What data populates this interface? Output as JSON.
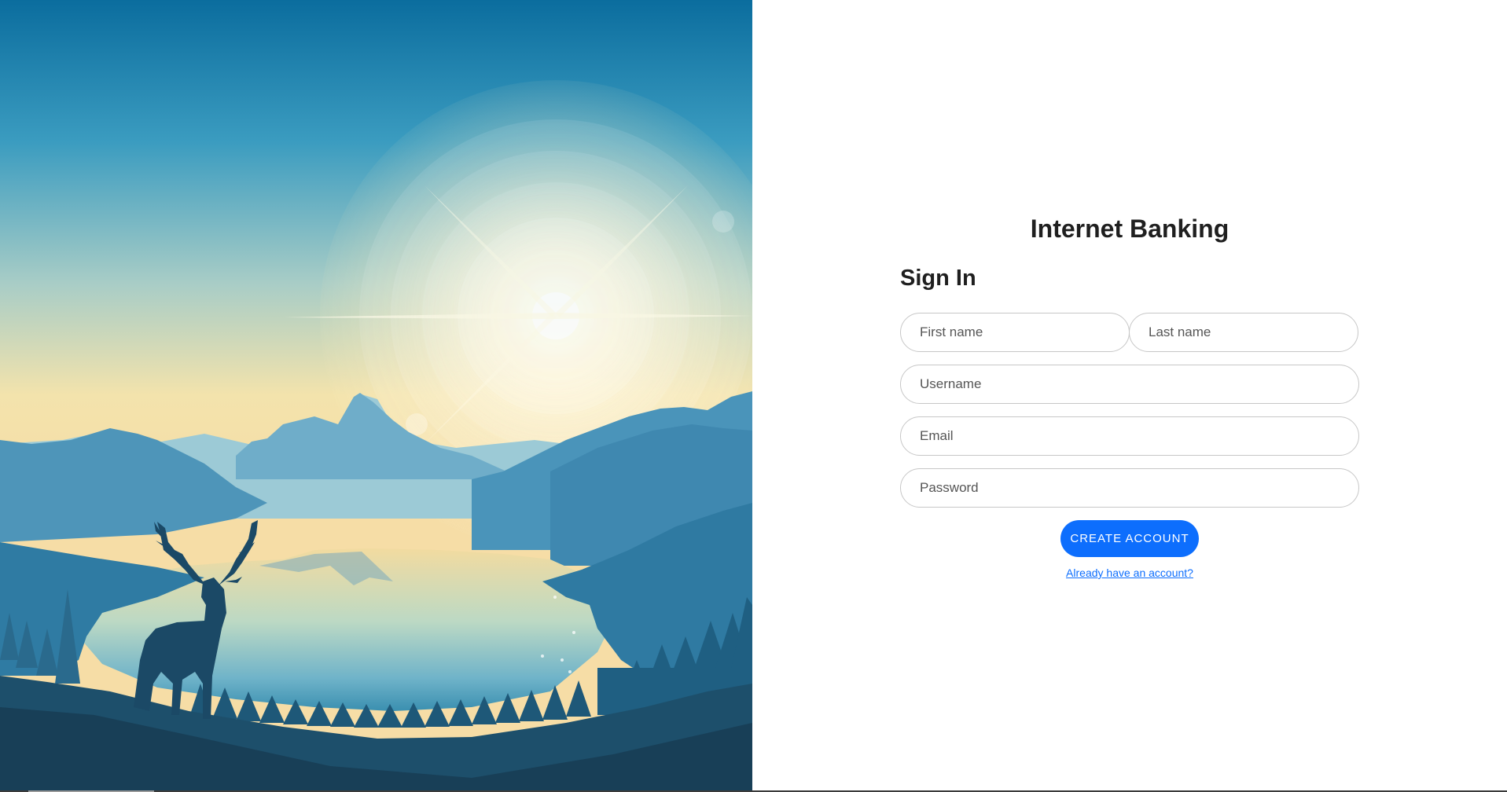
{
  "app": {
    "title": "Internet Banking"
  },
  "form": {
    "heading": "Sign In",
    "fields": {
      "first_name": {
        "placeholder": "First name",
        "value": ""
      },
      "last_name": {
        "placeholder": "Last name",
        "value": ""
      },
      "username": {
        "placeholder": "Username",
        "value": ""
      },
      "email": {
        "placeholder": "Email",
        "value": ""
      },
      "password": {
        "placeholder": "Password",
        "value": ""
      }
    },
    "submit_label": "CREATE ACCOUNT",
    "alt_link": "Already have an account?"
  },
  "illustration": {
    "subject": "deer silhouette by a mountain lake at sunrise"
  },
  "colors": {
    "accent": "#0d6efd",
    "sky_top": "#0b6d9e",
    "sky_glow": "#f3e3ac",
    "mountain": "#3f8fb3"
  }
}
